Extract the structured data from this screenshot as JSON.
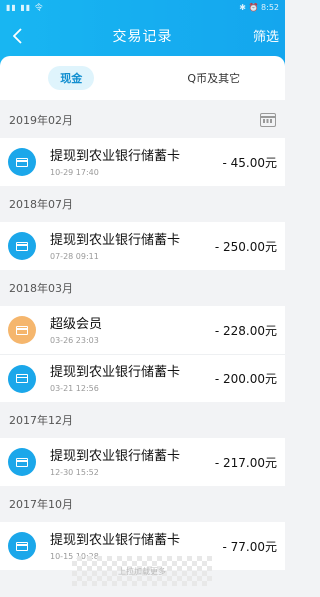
{
  "status": {
    "left": "▮▮ ▮▮ 令",
    "right": "✱ ⏰ 8:52"
  },
  "header": {
    "title": "交易记录",
    "filter_label": "筛选",
    "back_icon": "chevron-left-icon"
  },
  "tabs": [
    {
      "label": "现金",
      "active": true
    },
    {
      "label": "Q币及其它",
      "active": false
    }
  ],
  "colors": {
    "accent": "#14a6ee",
    "tab_active_bg": "#dff4fc",
    "icon_blue": "#1ba7ea",
    "icon_orange": "#f5b66d"
  },
  "groups": [
    {
      "month": "2019年02月",
      "items": [
        {
          "name": "提现到农业银行储蓄卡",
          "time": "10-29 17:40",
          "amount": "- 45.00元",
          "icon": "bank-card-icon"
        }
      ]
    },
    {
      "month": "2018年07月",
      "items": [
        {
          "name": "提现到农业银行储蓄卡",
          "time": "07-28 09:11",
          "amount": "- 250.00元",
          "icon": "bank-card-icon"
        }
      ]
    },
    {
      "month": "2018年03月",
      "items": [
        {
          "name": "超级会员",
          "time": "03-26 23:03",
          "amount": "- 228.00元",
          "icon": "vip-icon"
        },
        {
          "name": "提现到农业银行储蓄卡",
          "time": "03-21 12:56",
          "amount": "- 200.00元",
          "icon": "bank-card-icon"
        }
      ]
    },
    {
      "month": "2017年12月",
      "items": [
        {
          "name": "提现到农业银行储蓄卡",
          "time": "12-30 15:52",
          "amount": "- 217.00元",
          "icon": "bank-card-icon"
        }
      ]
    },
    {
      "month": "2017年10月",
      "items": [
        {
          "name": "提现到农业银行储蓄卡",
          "time": "10-15 10:28",
          "amount": "- 77.00元",
          "icon": "bank-card-icon"
        }
      ]
    }
  ],
  "footer": {
    "more_label": "上拉加载更多"
  }
}
